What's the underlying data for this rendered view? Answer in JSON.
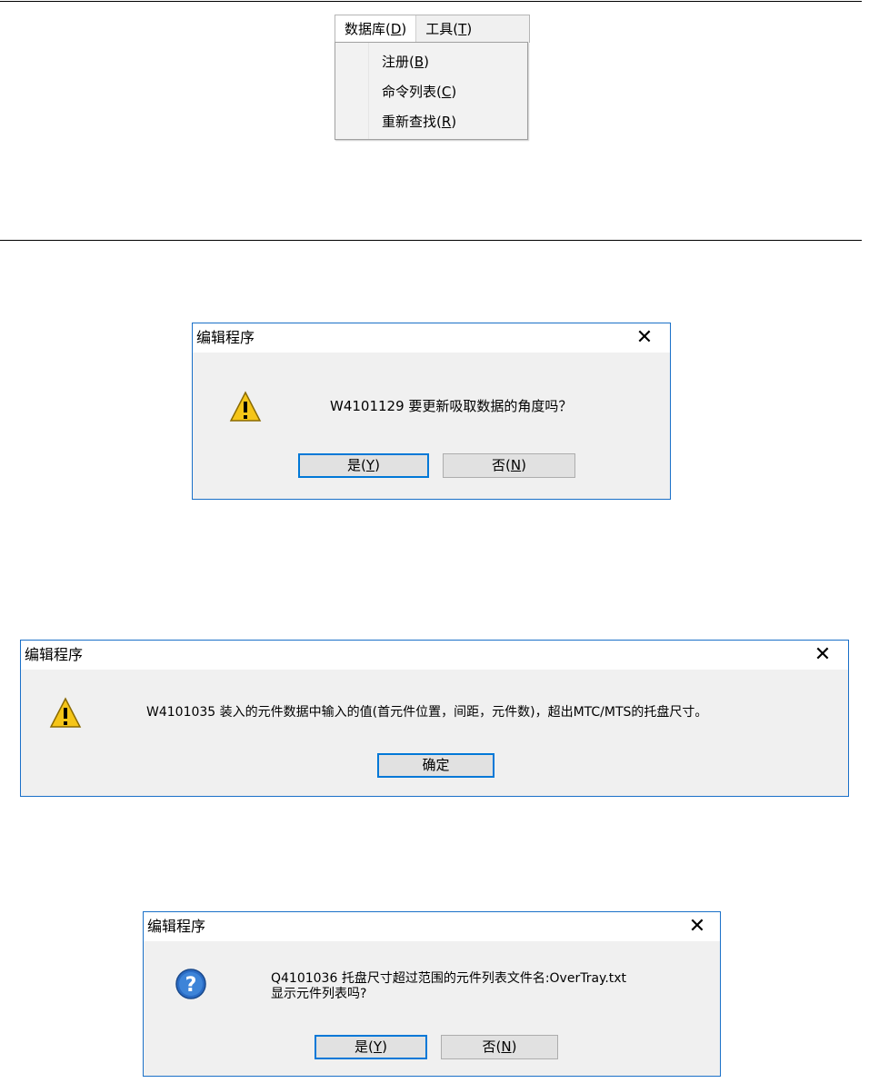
{
  "menu": {
    "bar": {
      "database": {
        "label": "数据库(",
        "key": "D",
        "end": ")"
      },
      "tools": {
        "label": "工具(",
        "key": "T",
        "end": ")"
      }
    },
    "items": [
      {
        "label": "注册(",
        "key": "B",
        "end": ")"
      },
      {
        "label": "命令列表(",
        "key": "C",
        "end": ")"
      },
      {
        "label": "重新查找(",
        "key": "R",
        "end": ")"
      }
    ]
  },
  "dialogs": [
    {
      "title": "编辑程序",
      "icon": "warning-icon",
      "message": "W4101129 要更新吸取数据的角度吗？",
      "yes": {
        "label": "是(",
        "key": "Y",
        "end": ")"
      },
      "no": {
        "label": "否(",
        "key": "N",
        "end": ")"
      }
    },
    {
      "title": "编辑程序",
      "icon": "warning-icon",
      "message": "W4101035 装入的元件数据中输入的值(首元件位置，间距，元件数)，超出MTC/MTS的托盘尺寸。",
      "ok": {
        "label": "确定"
      }
    },
    {
      "title": "编辑程序",
      "icon": "question-icon",
      "message_line1": "Q4101036 托盘尺寸超过范围的元件列表文件名:OverTray.txt",
      "message_line2": "显示元件列表吗?",
      "yes": {
        "label": "是(",
        "key": "Y",
        "end": ")"
      },
      "no": {
        "label": "否(",
        "key": "N",
        "end": ")"
      }
    }
  ],
  "colors": {
    "accent": "#0078d7",
    "dialog_border": "#1a70c8",
    "dialog_bg": "#f0f0f0",
    "warning_fill": "#f5c518",
    "question_fill": "#2a6bc4"
  }
}
